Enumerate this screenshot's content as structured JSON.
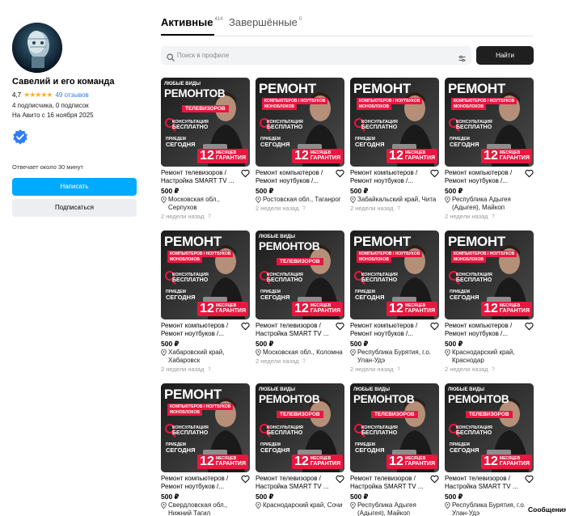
{
  "profile": {
    "name": "Савелий и его команда",
    "rating": "4,7",
    "stars": "★★★★★",
    "reviews": "49 отзывов",
    "followers": "4 подписчика, 0 подписок",
    "since": "На Авито с 16 ноября 2025",
    "answer_time": "Отвечает около 30 минут",
    "write_button": "Написать",
    "subscribe_button": "Подписаться"
  },
  "tabs": {
    "active_label": "Активные",
    "active_count": "414",
    "done_label": "Завершённые",
    "done_count": "0"
  },
  "search": {
    "placeholder": "Поиск в профиле",
    "value": "",
    "button": "Найти"
  },
  "colors": {
    "accent": "#00aaff",
    "badge_red": "#e8173f",
    "stars": "#ffb021"
  },
  "thumb_text": {
    "tv_top": "ЛЮБЫЕ ВИДЫ",
    "tv_big": "РЕМОНТ",
    "tv_big2": "РЕМОНТОВ",
    "tv_label": "ТЕЛЕВИЗОРОВ",
    "pc_big": "РЕМОНТ",
    "pc_label": "КОМПЬЮТЕРОВ / НОУТБУКОВ",
    "pc_label2": "МОНОБЛОКОВ",
    "cons_small": "КОНСУЛЬТАЦИЯ",
    "cons_big": "БЕСПЛАТНО",
    "come_small": "ПРИЕДЕМ",
    "come_big": "СЕГОДНЯ",
    "badge_num": "12",
    "badge_small": "МЕСЯЦЕВ",
    "badge_big": "ГАРАНТИЯ"
  },
  "listings": [
    {
      "kind": "tv",
      "title": "Ремонт телевизоров / Настройка SMART TV ...",
      "price": "500 ₽",
      "location": "Московская обл., Серпухов",
      "date": "2 недели назад"
    },
    {
      "kind": "pc",
      "title": "Ремонт компьютеров / Ремонт ноутбуков /...",
      "price": "500 ₽",
      "location": "Ростовская обл., Таганрог",
      "date": "2 недели назад"
    },
    {
      "kind": "pc",
      "title": "Ремонт компьютеров / Ремонт ноутбуков /...",
      "price": "500 ₽",
      "location": "Забайкальский край, Чита",
      "date": "2 недели назад"
    },
    {
      "kind": "pc",
      "title": "Ремонт компьютеров / Ремонт ноутбуков /...",
      "price": "500 ₽",
      "location": "Республика Адыгея (Адыгея), Майкоп",
      "date": "2 недели назад"
    },
    {
      "kind": "pc",
      "title": "Ремонт компьютеров / Ремонт ноутбуков /...",
      "price": "500 ₽",
      "location": "Хабаровский край, Хабаровск",
      "date": "2 недели назад"
    },
    {
      "kind": "tv",
      "title": "Ремонт телевизоров / Настройка SMART TV ...",
      "price": "500 ₽",
      "location": "Московская обл., Коломна",
      "date": "2 недели назад"
    },
    {
      "kind": "pc",
      "title": "Ремонт компьютеров / Ремонт ноутбуков /...",
      "price": "500 ₽",
      "location": "Республика Бурятия, г.о. Улан-Удэ",
      "date": "2 недели назад"
    },
    {
      "kind": "pc",
      "title": "Ремонт компьютеров / Ремонт ноутбуков /...",
      "price": "500 ₽",
      "location": "Краснодарский край, Краснодар",
      "date": "2 недели назад"
    },
    {
      "kind": "pc",
      "title": "Ремонт компьютеров / Ремонт ноутбуков /...",
      "price": "500 ₽",
      "location": "Свердловская обл., Нижний Тагил",
      "date": ""
    },
    {
      "kind": "tv",
      "title": "Ремонт телевизоров / Настройка SMART TV ...",
      "price": "500 ₽",
      "location": "Краснодарский край, Сочи",
      "date": ""
    },
    {
      "kind": "tv",
      "title": "Ремонт телевизоров / Настройка SMART TV ...",
      "price": "500 ₽",
      "location": "Республика Адыгея (Адыгея), Майкоп",
      "date": ""
    },
    {
      "kind": "tv",
      "title": "Ремонт телевизоров / Настройка SMART TV ...",
      "price": "500 ₽",
      "location": "Республика Бурятия, г.о. Улан-Удэ",
      "date": ""
    }
  ],
  "messages_button": "Сообщения"
}
